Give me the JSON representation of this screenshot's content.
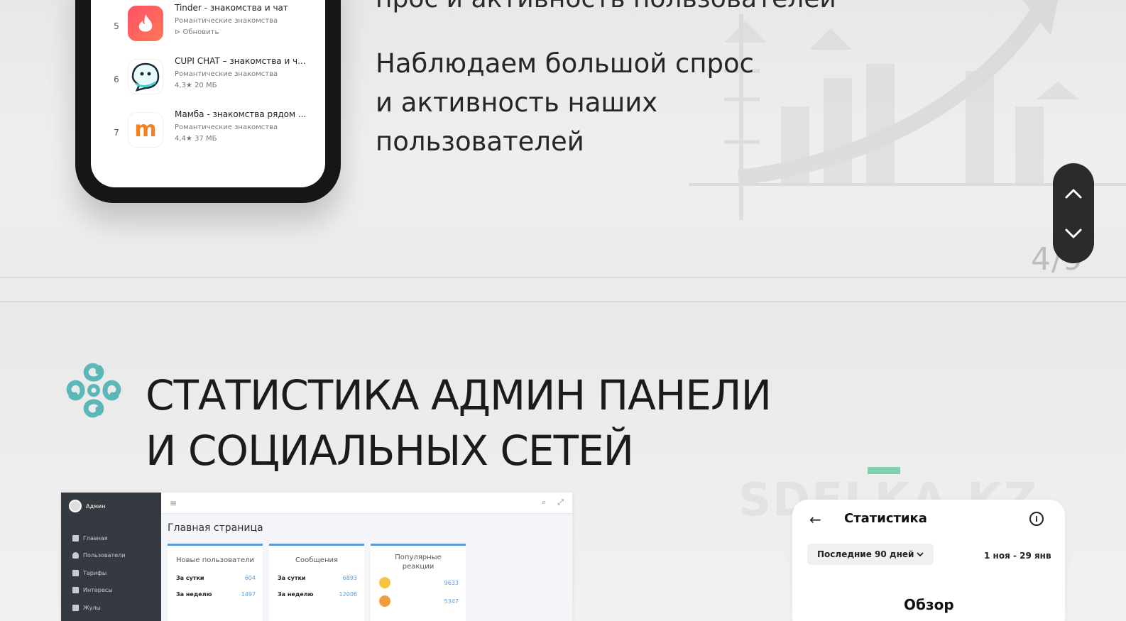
{
  "top_slide": {
    "partial_heading": "прос и активность пользователей",
    "text_lines": [
      "Наблюдаем большой спрос",
      "и активность наших",
      "пользователей"
    ],
    "page_counter": "4/9",
    "apps": [
      {
        "rank": "5",
        "name": "Tinder - знакомства и чат",
        "category": "Романтические знакомства",
        "meta": "⊳ Обновить",
        "icon": "tinder-icon"
      },
      {
        "rank": "6",
        "name": "CUPI CHAT – знакомства и ч...",
        "category": "Романтические знакомства",
        "meta": "4,3★   20 МБ",
        "icon": "cupi-chat-icon"
      },
      {
        "rank": "7",
        "name": "Мамба - знакомства рядом ...",
        "category": "Романтические знакомства",
        "meta": "4,4★   37 МБ",
        "icon": "mamba-icon"
      }
    ]
  },
  "bottom_slide": {
    "title": "СТАТИСТИКА АДМИН ПАНЕЛИ\nИ СОЦИАЛЬНЫХ СЕТЕЙ",
    "watermark": "SDELKA.KZ",
    "admin": {
      "user": "Админ",
      "menu": [
        "Главная",
        "Пользователи",
        "Тарифы",
        "Интересы",
        "Жулы"
      ],
      "heading": "Главная страница",
      "cards": [
        {
          "title": "Новые пользователи",
          "rows": [
            {
              "label": "За сутки",
              "value": "604"
            },
            {
              "label": "За неделю",
              "value": "1497"
            }
          ]
        },
        {
          "title": "Сообщения",
          "rows": [
            {
              "label": "За сутки",
              "value": "6893"
            },
            {
              "label": "За неделю",
              "value": "12006"
            }
          ]
        },
        {
          "title": "Популярные реакции",
          "rows": [
            {
              "label": "",
              "value": "9633"
            },
            {
              "label": "",
              "value": "5347"
            }
          ]
        }
      ]
    },
    "stats": {
      "title": "Статистика",
      "range": "Последние 90 дней",
      "dates": "1 ноя - 29 янв",
      "overview": "Обзор"
    }
  },
  "colors": {
    "accent_teal": "#5bb7b8",
    "admin_sidebar": "#343a40",
    "card_accent": "#5b9bd5",
    "green_bar": "#7fd1ad",
    "nav_pill": "#2b2b2b"
  }
}
